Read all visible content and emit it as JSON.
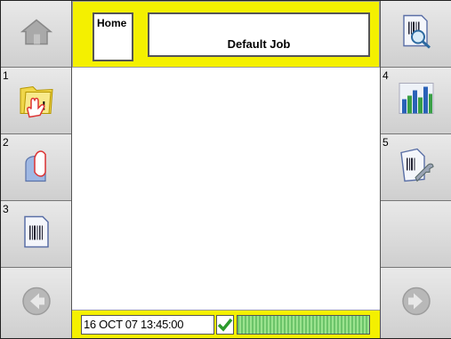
{
  "header": {
    "tab_label": "Home",
    "job_name": "Default Job"
  },
  "left_buttons": [
    {
      "id": "home",
      "icon": "home-icon",
      "number": ""
    },
    {
      "id": "jobs",
      "icon": "folder-warning-icon",
      "number": "1"
    },
    {
      "id": "ink",
      "icon": "ink-bottle-icon",
      "number": "2"
    },
    {
      "id": "barcode-doc",
      "icon": "barcode-document-icon",
      "number": "3"
    },
    {
      "id": "back",
      "icon": "back-arrow-icon",
      "number": ""
    }
  ],
  "right_buttons": [
    {
      "id": "search",
      "icon": "barcode-search-icon",
      "number": ""
    },
    {
      "id": "stats",
      "icon": "bar-chart-icon",
      "number": "4"
    },
    {
      "id": "tools",
      "icon": "barcode-wrench-icon",
      "number": "5"
    },
    {
      "id": "blank",
      "icon": "",
      "number": ""
    },
    {
      "id": "forward",
      "icon": "forward-arrow-icon",
      "number": ""
    }
  ],
  "status": {
    "datetime": "16 OCT 07 13:45:00",
    "ok_icon": "checkmark-icon",
    "level_fraction": 1.0
  },
  "colors": {
    "accent": "#f4f000",
    "status_ok": "#2c9a2c"
  }
}
